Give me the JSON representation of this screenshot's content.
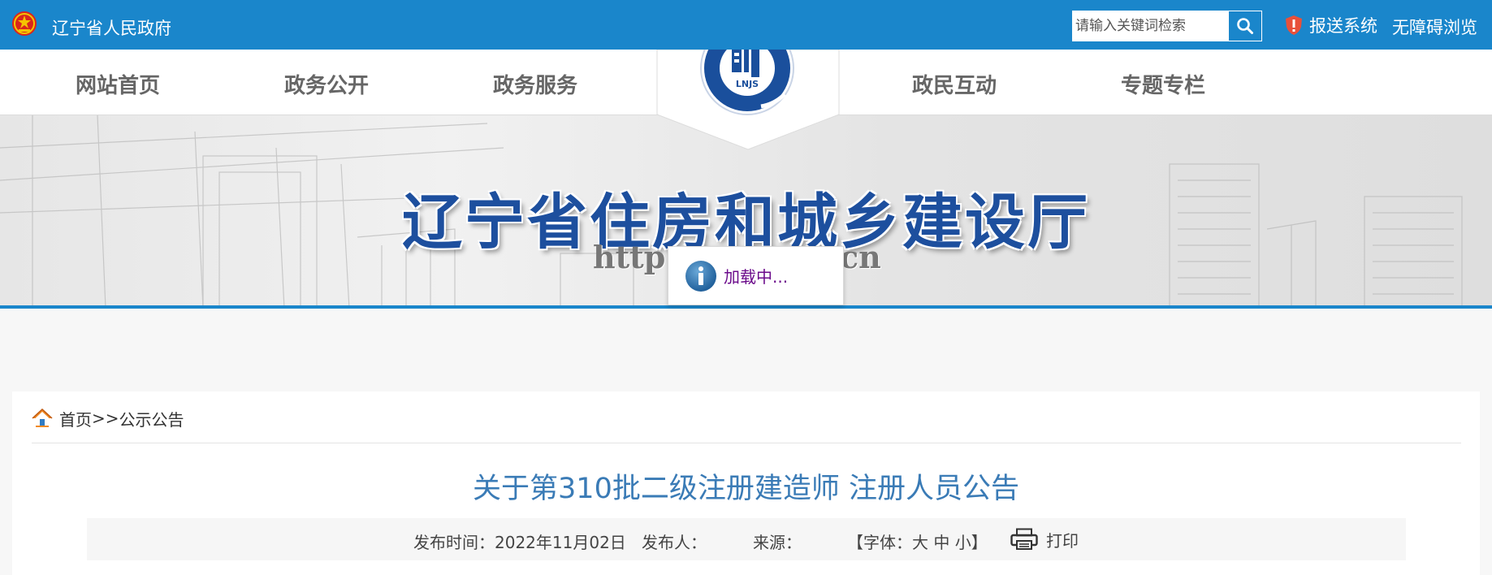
{
  "header": {
    "gov_name": "辽宁省人民政府",
    "search_placeholder": "请输入关键词检索",
    "report_label": "报送系统",
    "accessibility_label": "无障碍浏览",
    "colors": {
      "primary_blue": "#1a86cb"
    }
  },
  "nav": {
    "items": [
      {
        "label": "网站首页"
      },
      {
        "label": "政务公开"
      },
      {
        "label": "政务服务"
      },
      {
        "label": "政民互动"
      },
      {
        "label": "专题专栏"
      }
    ],
    "logo_text": "LNJS"
  },
  "banner": {
    "title": "辽宁省住房和城乡建设厅",
    "url_visible_head": "http:",
    "url_visible_tail": "cn"
  },
  "loading": {
    "text": "加载中..."
  },
  "breadcrumb": {
    "home": "首页",
    "separator": ">>",
    "current": "公示公告"
  },
  "article": {
    "title": "关于第310批二级注册建造师 注册人员公告",
    "publish_time": "发布时间：2022年11月02日",
    "publisher": "发布人：",
    "source": "来源：",
    "font_prefix": "【字体：",
    "font_large": "大",
    "font_medium": "中",
    "font_small": "小",
    "font_suffix": "】",
    "print": "打印",
    "title_color": "#3a7bb6"
  },
  "icons": [
    "national-emblem-icon",
    "search-icon",
    "report-shield-icon",
    "lnjs-logo",
    "info-icon",
    "home-icon",
    "printer-icon"
  ]
}
